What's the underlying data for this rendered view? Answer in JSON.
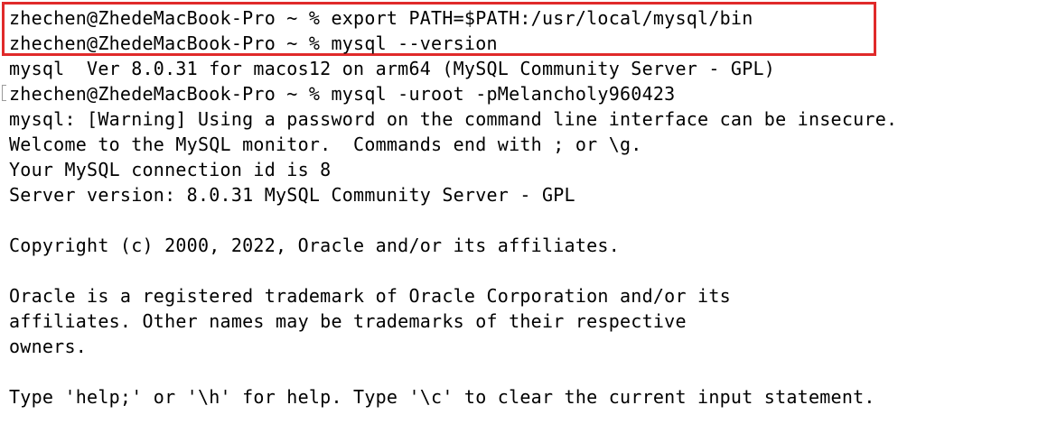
{
  "terminal": {
    "highlight_color": "#e02a2a",
    "lines": [
      "zhechen@ZhedeMacBook-Pro ~ % export PATH=$PATH:/usr/local/mysql/bin",
      "zhechen@ZhedeMacBook-Pro ~ % mysql --version",
      "mysql  Ver 8.0.31 for macos12 on arm64 (MySQL Community Server - GPL)",
      "zhechen@ZhedeMacBook-Pro ~ % mysql -uroot -pMelancholy960423",
      "mysql: [Warning] Using a password on the command line interface can be insecure.",
      "Welcome to the MySQL monitor.  Commands end with ; or \\g.",
      "Your MySQL connection id is 8",
      "Server version: 8.0.31 MySQL Community Server - GPL",
      "",
      "Copyright (c) 2000, 2022, Oracle and/or its affiliates.",
      "",
      "Oracle is a registered trademark of Oracle Corporation and/or its",
      "affiliates. Other names may be trademarks of their respective",
      "owners.",
      "",
      "Type 'help;' or '\\h' for help. Type '\\c' to clear the current input statement."
    ]
  }
}
